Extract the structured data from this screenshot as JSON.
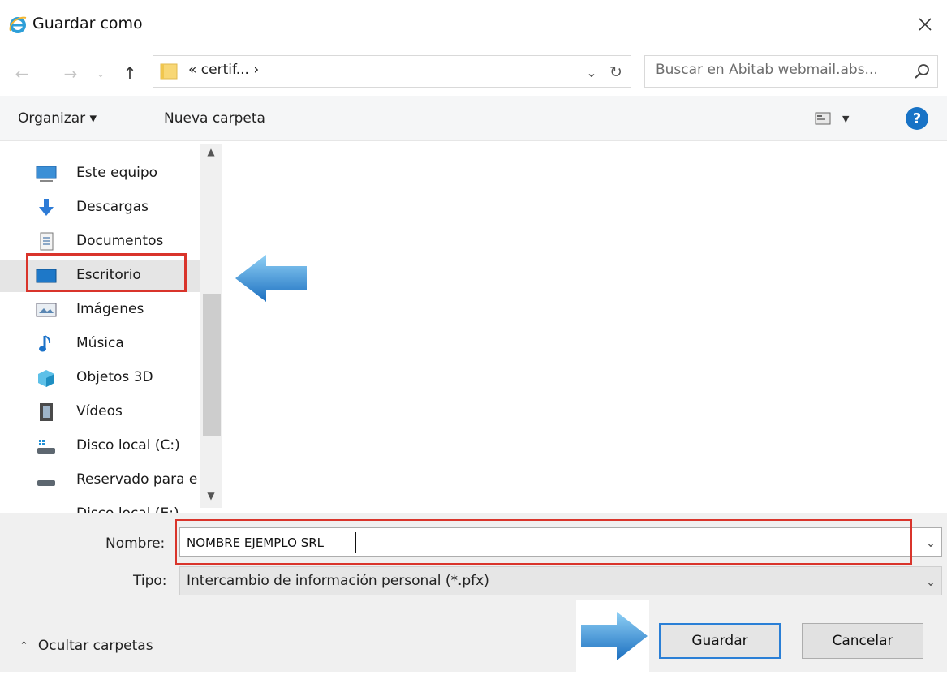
{
  "window": {
    "title": "Guardar como",
    "icon": "internet-explorer-icon"
  },
  "address": {
    "path": "« certif... ›"
  },
  "search": {
    "placeholder": "Buscar en Abitab webmail.abs..."
  },
  "toolbar": {
    "organize_label": "Organizar ▾",
    "new_folder_label": "Nueva carpeta"
  },
  "nav": {
    "items": [
      {
        "label": "Este equipo",
        "icon": "computer-icon"
      },
      {
        "label": "Descargas",
        "icon": "download-icon"
      },
      {
        "label": "Documentos",
        "icon": "document-icon"
      },
      {
        "label": "Escritorio",
        "icon": "desktop-icon",
        "selected": true
      },
      {
        "label": "Imágenes",
        "icon": "pictures-icon"
      },
      {
        "label": "Música",
        "icon": "music-icon"
      },
      {
        "label": "Objetos 3D",
        "icon": "3d-objects-icon"
      },
      {
        "label": "Vídeos",
        "icon": "videos-icon"
      },
      {
        "label": "Disco local (C:)",
        "icon": "drive-icon"
      },
      {
        "label": "Reservado para e",
        "icon": "drive-icon"
      },
      {
        "label": "Disco local (E:)",
        "icon": "drive-icon"
      }
    ]
  },
  "form": {
    "name_label": "Nombre:",
    "name_value": "NOMBRE EJEMPLO SRL",
    "type_label": "Tipo:",
    "type_value": "Intercambio de información personal (*.pfx)"
  },
  "footer": {
    "hide_folders_label": "Ocultar carpetas",
    "save_label": "Guardar",
    "cancel_label": "Cancelar"
  },
  "colors": {
    "highlight": "#d9342b",
    "accent": "#2a7fd6"
  }
}
